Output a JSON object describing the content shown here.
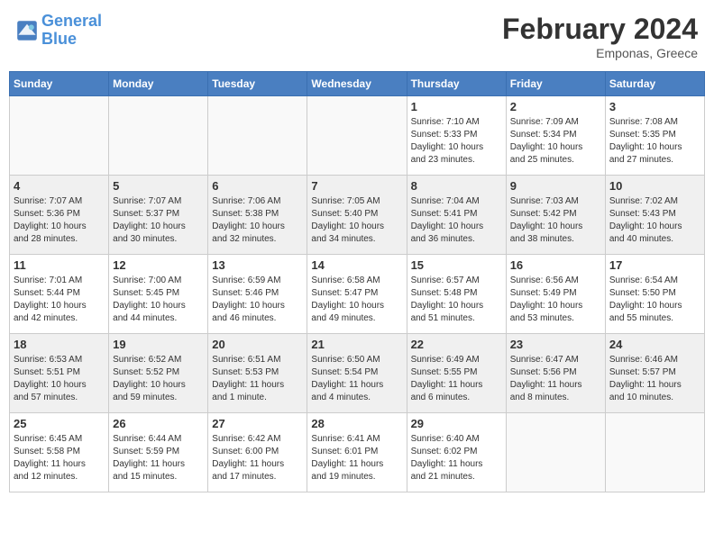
{
  "header": {
    "logo_line1": "General",
    "logo_line2": "Blue",
    "month": "February 2024",
    "location": "Emponas, Greece"
  },
  "weekdays": [
    "Sunday",
    "Monday",
    "Tuesday",
    "Wednesday",
    "Thursday",
    "Friday",
    "Saturday"
  ],
  "weeks": [
    [
      {
        "day": "",
        "info": ""
      },
      {
        "day": "",
        "info": ""
      },
      {
        "day": "",
        "info": ""
      },
      {
        "day": "",
        "info": ""
      },
      {
        "day": "1",
        "info": "Sunrise: 7:10 AM\nSunset: 5:33 PM\nDaylight: 10 hours\nand 23 minutes."
      },
      {
        "day": "2",
        "info": "Sunrise: 7:09 AM\nSunset: 5:34 PM\nDaylight: 10 hours\nand 25 minutes."
      },
      {
        "day": "3",
        "info": "Sunrise: 7:08 AM\nSunset: 5:35 PM\nDaylight: 10 hours\nand 27 minutes."
      }
    ],
    [
      {
        "day": "4",
        "info": "Sunrise: 7:07 AM\nSunset: 5:36 PM\nDaylight: 10 hours\nand 28 minutes."
      },
      {
        "day": "5",
        "info": "Sunrise: 7:07 AM\nSunset: 5:37 PM\nDaylight: 10 hours\nand 30 minutes."
      },
      {
        "day": "6",
        "info": "Sunrise: 7:06 AM\nSunset: 5:38 PM\nDaylight: 10 hours\nand 32 minutes."
      },
      {
        "day": "7",
        "info": "Sunrise: 7:05 AM\nSunset: 5:40 PM\nDaylight: 10 hours\nand 34 minutes."
      },
      {
        "day": "8",
        "info": "Sunrise: 7:04 AM\nSunset: 5:41 PM\nDaylight: 10 hours\nand 36 minutes."
      },
      {
        "day": "9",
        "info": "Sunrise: 7:03 AM\nSunset: 5:42 PM\nDaylight: 10 hours\nand 38 minutes."
      },
      {
        "day": "10",
        "info": "Sunrise: 7:02 AM\nSunset: 5:43 PM\nDaylight: 10 hours\nand 40 minutes."
      }
    ],
    [
      {
        "day": "11",
        "info": "Sunrise: 7:01 AM\nSunset: 5:44 PM\nDaylight: 10 hours\nand 42 minutes."
      },
      {
        "day": "12",
        "info": "Sunrise: 7:00 AM\nSunset: 5:45 PM\nDaylight: 10 hours\nand 44 minutes."
      },
      {
        "day": "13",
        "info": "Sunrise: 6:59 AM\nSunset: 5:46 PM\nDaylight: 10 hours\nand 46 minutes."
      },
      {
        "day": "14",
        "info": "Sunrise: 6:58 AM\nSunset: 5:47 PM\nDaylight: 10 hours\nand 49 minutes."
      },
      {
        "day": "15",
        "info": "Sunrise: 6:57 AM\nSunset: 5:48 PM\nDaylight: 10 hours\nand 51 minutes."
      },
      {
        "day": "16",
        "info": "Sunrise: 6:56 AM\nSunset: 5:49 PM\nDaylight: 10 hours\nand 53 minutes."
      },
      {
        "day": "17",
        "info": "Sunrise: 6:54 AM\nSunset: 5:50 PM\nDaylight: 10 hours\nand 55 minutes."
      }
    ],
    [
      {
        "day": "18",
        "info": "Sunrise: 6:53 AM\nSunset: 5:51 PM\nDaylight: 10 hours\nand 57 minutes."
      },
      {
        "day": "19",
        "info": "Sunrise: 6:52 AM\nSunset: 5:52 PM\nDaylight: 10 hours\nand 59 minutes."
      },
      {
        "day": "20",
        "info": "Sunrise: 6:51 AM\nSunset: 5:53 PM\nDaylight: 11 hours\nand 1 minute."
      },
      {
        "day": "21",
        "info": "Sunrise: 6:50 AM\nSunset: 5:54 PM\nDaylight: 11 hours\nand 4 minutes."
      },
      {
        "day": "22",
        "info": "Sunrise: 6:49 AM\nSunset: 5:55 PM\nDaylight: 11 hours\nand 6 minutes."
      },
      {
        "day": "23",
        "info": "Sunrise: 6:47 AM\nSunset: 5:56 PM\nDaylight: 11 hours\nand 8 minutes."
      },
      {
        "day": "24",
        "info": "Sunrise: 6:46 AM\nSunset: 5:57 PM\nDaylight: 11 hours\nand 10 minutes."
      }
    ],
    [
      {
        "day": "25",
        "info": "Sunrise: 6:45 AM\nSunset: 5:58 PM\nDaylight: 11 hours\nand 12 minutes."
      },
      {
        "day": "26",
        "info": "Sunrise: 6:44 AM\nSunset: 5:59 PM\nDaylight: 11 hours\nand 15 minutes."
      },
      {
        "day": "27",
        "info": "Sunrise: 6:42 AM\nSunset: 6:00 PM\nDaylight: 11 hours\nand 17 minutes."
      },
      {
        "day": "28",
        "info": "Sunrise: 6:41 AM\nSunset: 6:01 PM\nDaylight: 11 hours\nand 19 minutes."
      },
      {
        "day": "29",
        "info": "Sunrise: 6:40 AM\nSunset: 6:02 PM\nDaylight: 11 hours\nand 21 minutes."
      },
      {
        "day": "",
        "info": ""
      },
      {
        "day": "",
        "info": ""
      }
    ]
  ]
}
